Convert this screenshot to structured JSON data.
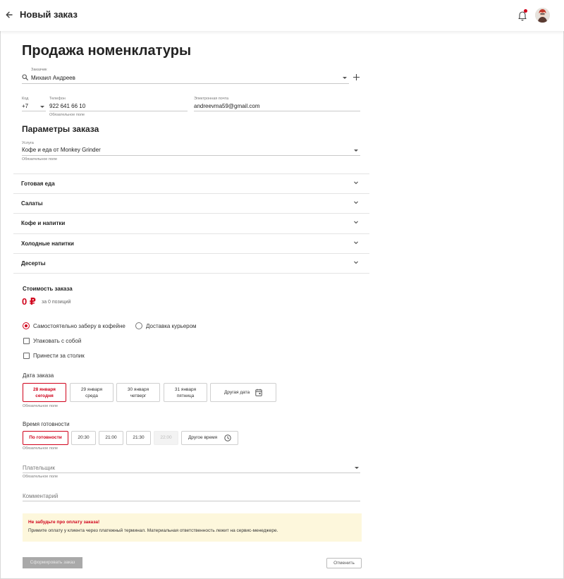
{
  "app": {
    "title": "Новый заказ"
  },
  "page": {
    "title": "Продажа номенклатуры"
  },
  "customer": {
    "label": "Заказчик",
    "value": "Михаил Андреев"
  },
  "phone": {
    "code_label": "Код",
    "code_value": "+7",
    "phone_label": "Телефон",
    "phone_value": "922 641 66 10",
    "required_hint": "Обязательное поле"
  },
  "email": {
    "label": "Электронная почта",
    "value": "andreevma59@gmail.com"
  },
  "order_params": {
    "title": "Параметры заказа",
    "service_label": "Услуга",
    "service_value": "Кофе и еда от Monkey Grinder",
    "required_hint": "Обязательное поле"
  },
  "categories": [
    {
      "label": "Готовая еда"
    },
    {
      "label": "Салаты"
    },
    {
      "label": "Кофе и напитки"
    },
    {
      "label": "Холодные напитки"
    },
    {
      "label": "Десерты"
    }
  ],
  "cost": {
    "title": "Стоимость заказа",
    "amount": "0 ₽",
    "subtitle": "за 0 позиций"
  },
  "delivery": {
    "pickup_label": "Самостоятельно заберу в кофейне",
    "courier_label": "Доставка курьером",
    "selected": "pickup"
  },
  "options": {
    "pack_label": "Упаковать с собой",
    "table_label": "Принести за столик"
  },
  "order_date": {
    "title": "Дата заказа",
    "dates": [
      {
        "date": "28 января",
        "day": "сегодня",
        "selected": true
      },
      {
        "date": "29 января",
        "day": "среда",
        "selected": false
      },
      {
        "date": "30 января",
        "day": "четверг",
        "selected": false
      },
      {
        "date": "31 января",
        "day": "пятница",
        "selected": false
      }
    ],
    "other_label": "Другая дата",
    "required_hint": "Обязательное поле"
  },
  "ready_time": {
    "title": "Время готовности",
    "times": [
      {
        "label": "По готовности",
        "state": "selected"
      },
      {
        "label": "20:30",
        "state": "normal"
      },
      {
        "label": "21:00",
        "state": "normal"
      },
      {
        "label": "21:30",
        "state": "normal"
      },
      {
        "label": "22:00",
        "state": "disabled"
      }
    ],
    "other_label": "Другое время",
    "required_hint": "Обязательное поле"
  },
  "payer": {
    "placeholder": "Плательщик",
    "required_hint": "Обязательное поле"
  },
  "comment": {
    "placeholder": "Комментарий"
  },
  "notice": {
    "title": "Не забудьте про оплату заказа!",
    "text": "Примите оплату у клиента через платежный терминал. Материальная ответственность лежит на сервис-менеджере."
  },
  "actions": {
    "submit_label": "Сформировать заказ",
    "cancel_label": "Отменить"
  },
  "colors": {
    "accent": "#d0021b",
    "notice_bg": "#fdf7dc"
  }
}
